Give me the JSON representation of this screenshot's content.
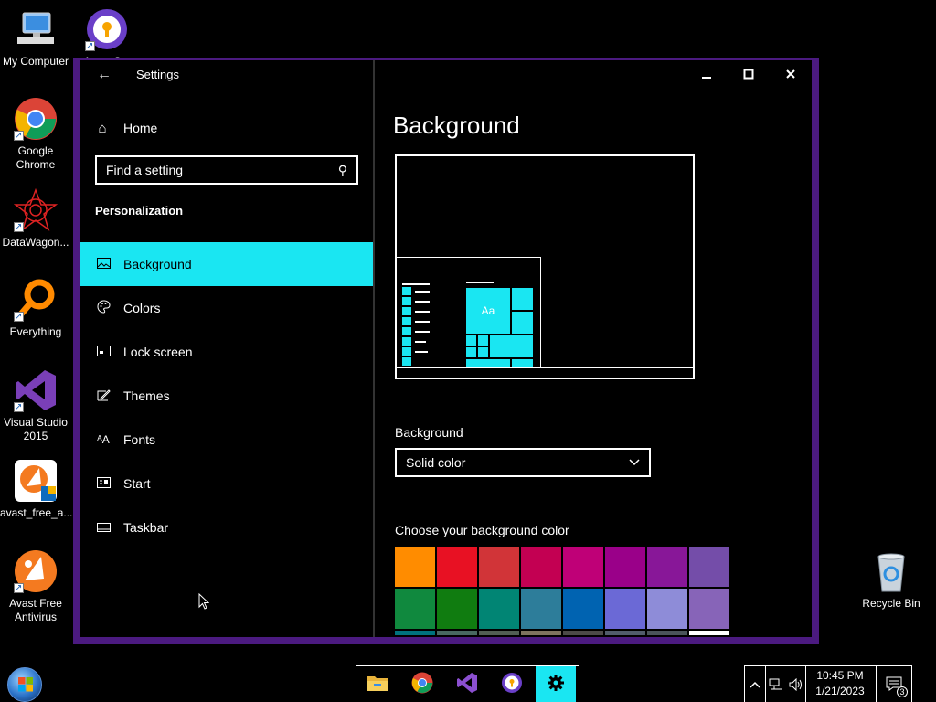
{
  "desktop": {
    "icons": [
      {
        "label": "My Computer"
      },
      {
        "label": "Avast S..."
      },
      {
        "label": "Google Chrome"
      },
      {
        "label": "DataWagon..."
      },
      {
        "label": "Everything"
      },
      {
        "label": "Visual Studio 2015"
      },
      {
        "label": "avast_free_a..."
      },
      {
        "label": "Avast Free Antivirus"
      },
      {
        "label": "Recycle Bin"
      }
    ]
  },
  "window": {
    "title": "Settings",
    "controls": {
      "minimize": "—",
      "maximize": "☐",
      "close": "✕"
    }
  },
  "nav": {
    "home_label": "Home",
    "search_placeholder": "Find a setting",
    "section": "Personalization",
    "items": [
      {
        "label": "Background",
        "icon": "image-icon",
        "glyph": "▭"
      },
      {
        "label": "Colors",
        "icon": "palette-icon",
        "glyph": "◕"
      },
      {
        "label": "Lock screen",
        "icon": "lock-screen-icon",
        "glyph": "▢"
      },
      {
        "label": "Themes",
        "icon": "themes-icon",
        "glyph": "✎"
      },
      {
        "label": "Fonts",
        "icon": "fonts-icon",
        "glyph": "A"
      },
      {
        "label": "Start",
        "icon": "start-icon",
        "glyph": "☷"
      },
      {
        "label": "Taskbar",
        "icon": "taskbar-icon",
        "glyph": "▬"
      }
    ]
  },
  "main": {
    "title": "Background",
    "preview_tile_text": "Aa",
    "background_label": "Background",
    "background_value": "Solid color",
    "color_label": "Choose your background color",
    "swatch_colors": [
      "#ff8c00",
      "#e81123",
      "#d13438",
      "#c30052",
      "#bf0077",
      "#9a0089",
      "#881798",
      "#744da9",
      "#10893e",
      "#107c10",
      "#018574",
      "#2d7d9a",
      "#0063b1",
      "#6b69d6",
      "#8e8cd8",
      "#8764b8",
      "#00727d",
      "#486860",
      "#525e54",
      "#7e735f",
      "#4c4a48",
      "#515c6b",
      "#4a5459",
      "#ffffff"
    ]
  },
  "taskbar": {
    "apps": [
      {
        "name": "file-explorer"
      },
      {
        "name": "chrome"
      },
      {
        "name": "visual-studio"
      },
      {
        "name": "avast"
      },
      {
        "name": "settings"
      }
    ],
    "time": "10:45 PM",
    "date": "1/21/2023",
    "notification_count": "3"
  },
  "colors": {
    "accent": "#1ae6f2",
    "window_frame": "#4b1a80"
  }
}
